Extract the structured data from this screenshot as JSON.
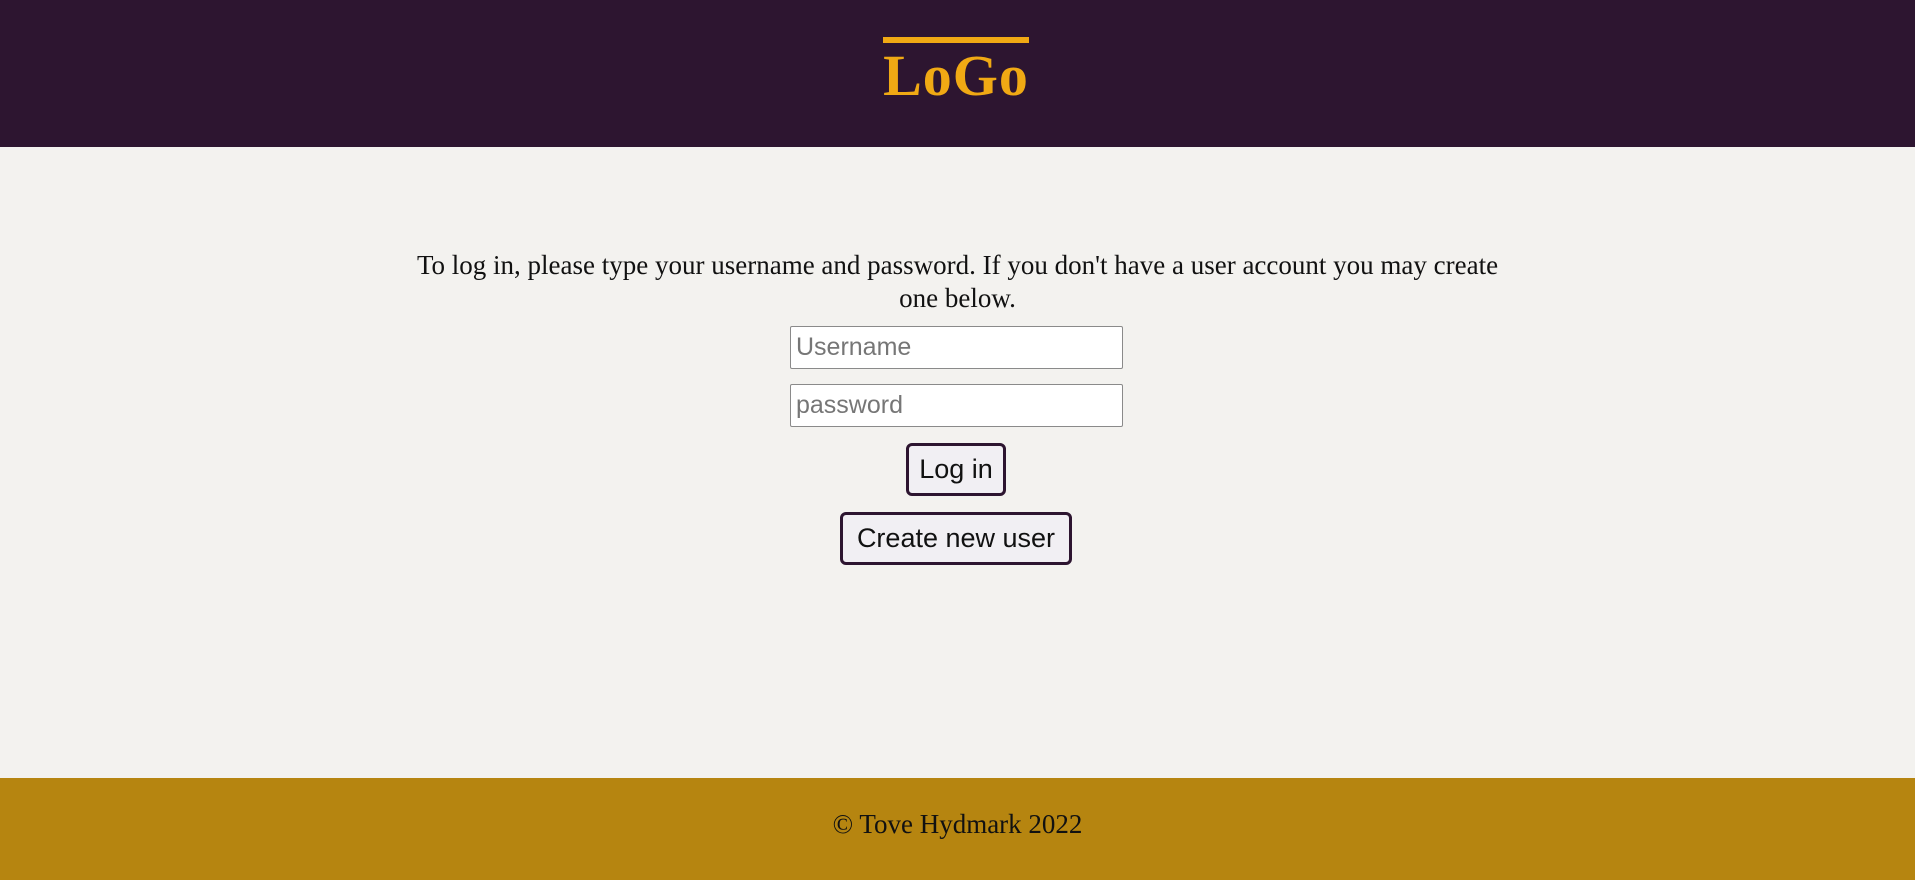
{
  "header": {
    "logo_text": "LoGo"
  },
  "login": {
    "intro_text": "To log in, please type your username and password. If you don't have a user account you may create one below.",
    "username_placeholder": "Username",
    "username_value": "",
    "password_placeholder": "password",
    "password_value": "",
    "login_label": "Log in",
    "create_user_label": "Create new user"
  },
  "footer": {
    "copyright": "© Tove Hydmark 2022"
  },
  "colors": {
    "header_bg": "#2d1530",
    "logo": "#f0a914",
    "page_bg": "#f3f2ef",
    "footer_bg": "#b68510"
  }
}
